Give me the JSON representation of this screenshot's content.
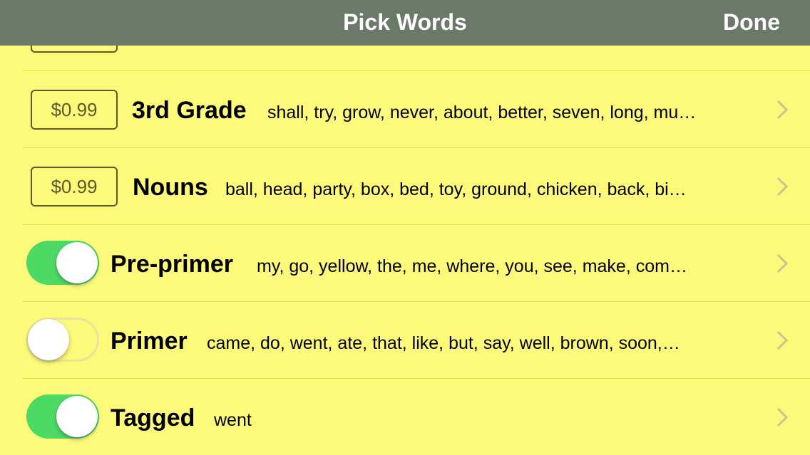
{
  "navbar": {
    "title": "Pick Words",
    "done_label": "Done"
  },
  "colors": {
    "background": "#fdf97a",
    "navbar": "#6b7969",
    "toggle_on": "#4cd964",
    "price_border": "#5e5a2c"
  },
  "rows": [
    {
      "control": "price",
      "price": "$0.99",
      "title": "3rd Grade",
      "words": "shall, try, grow, never, about, better, seven, long, mu…"
    },
    {
      "control": "price",
      "price": "$0.99",
      "title": "Nouns",
      "words": "ball, head, party, box, bed, toy, ground, chicken, back, bi…"
    },
    {
      "control": "toggle",
      "enabled": true,
      "title": "Pre-primer",
      "words": "my, go, yellow, the, me, where, you, see, make, com…"
    },
    {
      "control": "toggle",
      "enabled": false,
      "title": "Primer",
      "words": "came, do, went, ate, that, like, but, say, well, brown, soon,…"
    },
    {
      "control": "toggle",
      "enabled": true,
      "title": "Tagged",
      "words": "went"
    }
  ],
  "icons": {
    "row_disclosure": "chevron-right-icon"
  }
}
